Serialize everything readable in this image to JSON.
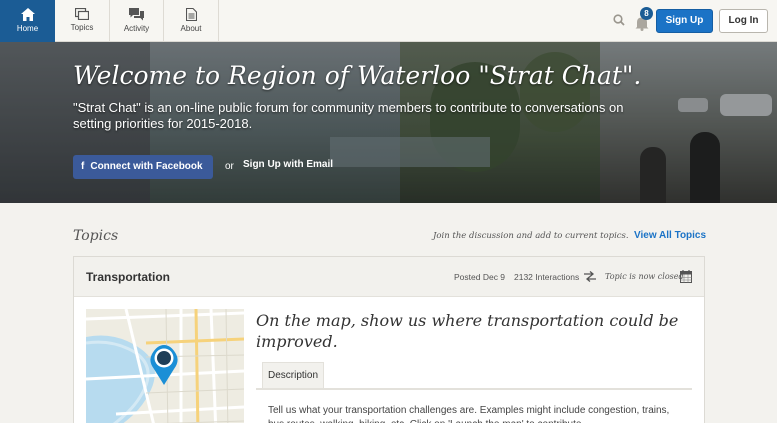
{
  "nav": {
    "items": [
      {
        "label": "Home",
        "icon": "home-icon",
        "active": true
      },
      {
        "label": "Topics",
        "icon": "topics-icon"
      },
      {
        "label": "Activity",
        "icon": "activity-icon"
      },
      {
        "label": "About",
        "icon": "about-icon"
      }
    ],
    "notifications_count": "8",
    "signup_label": "Sign Up",
    "login_label": "Log In"
  },
  "hero": {
    "title": "Welcome to Region of Waterloo \"Strat Chat\".",
    "subtitle": "\"Strat Chat\" is an on-line public forum for community members to contribute to conversations on setting priorities for 2015-2018.",
    "facebook_label": "Connect with Facebook",
    "or_label": "or",
    "email_label": "Sign Up with Email"
  },
  "topics": {
    "heading": "Topics",
    "hint": "Join the discussion and add to current topics.",
    "view_all_label": "View All Topics",
    "card": {
      "title": "Transportation",
      "posted": "Posted Dec 9",
      "interactions": "2132 Interactions",
      "status": "Topic is now closed",
      "question": "On the map, show us where transportation could be improved.",
      "tab_label": "Description",
      "description": "Tell us what your transportation challenges are. Examples might include congestion, trains, bus routes, walking, biking, etc. Click on 'Launch the map' to contribute."
    }
  },
  "colors": {
    "brand": "#1b5c95",
    "primary_button": "#1b73c6",
    "facebook": "#3b5a9a",
    "link": "#1b73c6",
    "map_pin": "#1b8fd6"
  }
}
